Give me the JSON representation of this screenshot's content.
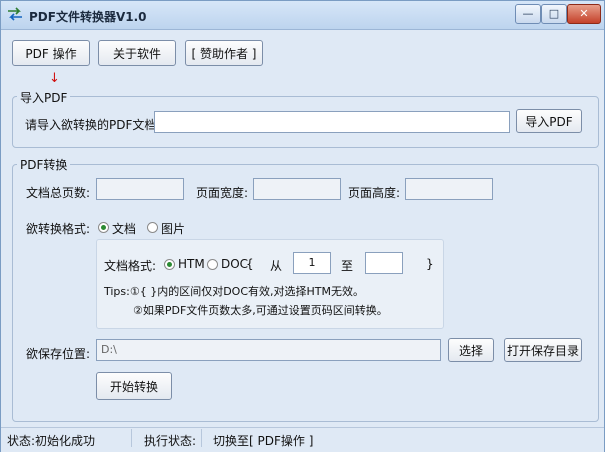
{
  "window": {
    "title": "PDF文件转换器V1.0",
    "controls": {
      "minimize": "—",
      "maximize": "□",
      "close": "✕"
    }
  },
  "toolbar": {
    "pdf_ops": "PDF 操作",
    "about": "关于软件",
    "sponsor": "[ 赞助作者 ]"
  },
  "import_section": {
    "title": "导入PDF",
    "label": "请导入欲转换的PDF文档:",
    "path_value": "",
    "import_button": "导入PDF"
  },
  "convert_section": {
    "title": "PDF转换",
    "total_pages_label": "文档总页数:",
    "total_pages_value": "",
    "page_width_label": "页面宽度:",
    "page_width_value": "",
    "page_height_label": "页面高度:",
    "page_height_value": "",
    "format_label": "欲转换格式:",
    "format_options": [
      {
        "label": "文档",
        "checked": true
      },
      {
        "label": "图片",
        "checked": false
      }
    ],
    "doc_format": {
      "label": "文档格式:",
      "options": [
        {
          "label": "HTM",
          "checked": true
        },
        {
          "label": "DOC",
          "checked": false
        }
      ],
      "brace_open": "{",
      "from_label": "从",
      "from_value": "1",
      "to_label": "至",
      "to_value": "",
      "brace_close": "}"
    },
    "tips_line1": "Tips:①{ }内的区间仅对DOC有效,对选择HTM无效。",
    "tips_line2": "②如果PDF文件页数太多,可通过设置页码区间转换。",
    "save_label": "欲保存位置:",
    "save_path": "D:\\",
    "choose_button": "选择",
    "open_folder_button": "打开保存目录",
    "start_button": "开始转换"
  },
  "statusbar": {
    "status": "状态:初始化成功",
    "exec_label": "执行状态:",
    "exec_value": "切换至[ PDF操作 ]"
  },
  "colors": {
    "titlebar": "#c9dcf2",
    "window_bg": "#dfe9f5",
    "close_button": "#c4412a",
    "arrow": "#d01010",
    "radio_dot": "#2b8a32"
  }
}
